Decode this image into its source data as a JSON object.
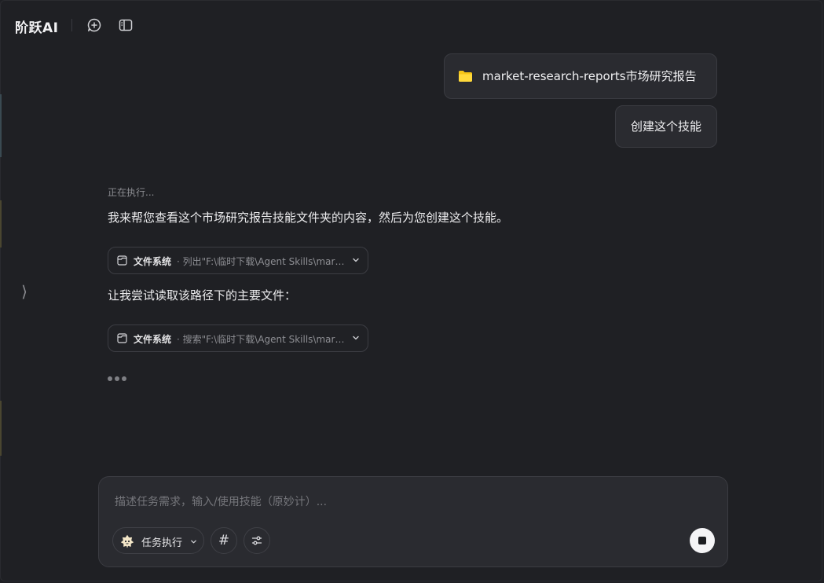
{
  "header": {
    "brand": "阶跃AI",
    "icons": [
      "new-chat-icon",
      "sidebar-panel-icon"
    ]
  },
  "conversation": {
    "user_messages": [
      {
        "type": "file",
        "icon": "folder-icon",
        "text": "market-research-reports市场研究报告"
      },
      {
        "type": "text",
        "text": "创建这个技能"
      }
    ],
    "assistant": {
      "status": "正在执行...",
      "intro": "我来帮您查看这个市场研究报告技能文件夹的内容，然后为您创建这个技能。",
      "tool_calls": [
        {
          "name": "文件系统",
          "detail": "· 列出\"F:\\临时下载\\Agent Skills\\market-research-reports\""
        },
        {
          "name": "文件系统",
          "detail": "· 搜索\"F:\\临时下载\\Agent Skills\\market-research-reports\""
        }
      ],
      "followup": "让我尝试读取该路径下的主要文件："
    }
  },
  "composer": {
    "placeholder": "描述任务需求，输入/使用技能（原妙计）...",
    "value": "",
    "mode_label": "任务执行",
    "hash_label": "#",
    "icons": [
      "settings-sliders-icon",
      "stop-icon"
    ]
  },
  "colors": {
    "background": "#1f2024",
    "bubble": "#2a2b30",
    "folder": "#f5c518"
  }
}
